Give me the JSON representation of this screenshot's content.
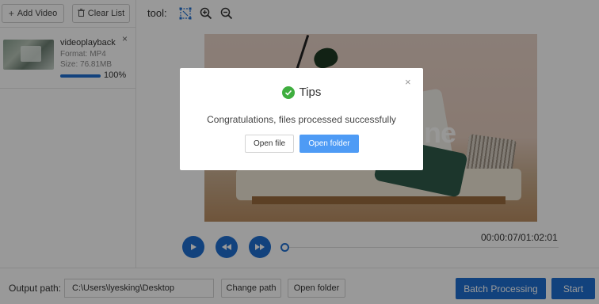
{
  "left_panel": {
    "add_label": "Add Video",
    "clear_label": "Clear List",
    "files": [
      {
        "name": "videoplayback",
        "format": "Format:  MP4",
        "size": "Size:  76.81MB",
        "progress_percent": 100,
        "progress_label": "100%",
        "close": "×"
      }
    ]
  },
  "toolbar": {
    "label": "tool:",
    "icons": [
      "crop-icon",
      "zoom-in-icon",
      "zoom-out-icon"
    ]
  },
  "player": {
    "timecode": "00:00:07/01:02:01",
    "video_overlay_text": "ine",
    "position_percent": 0
  },
  "bottom_bar": {
    "output_label": "Output path:",
    "output_path": "C:\\Users\\lyesking\\Desktop",
    "change_path_label": "Change path",
    "open_folder_label": "Open folder",
    "batch_label": "Batch Processing",
    "start_label": "Start"
  },
  "dialog": {
    "title": "Tips",
    "message": "Congratulations, files processed successfully",
    "open_file_label": "Open file",
    "open_folder_label": "Open folder",
    "close": "×"
  },
  "colors": {
    "accent": "#1f6fd1",
    "dialog_primary": "#4e9bf5",
    "success": "#3fae3f",
    "overlay": "rgba(0,0,0,0.40)"
  }
}
